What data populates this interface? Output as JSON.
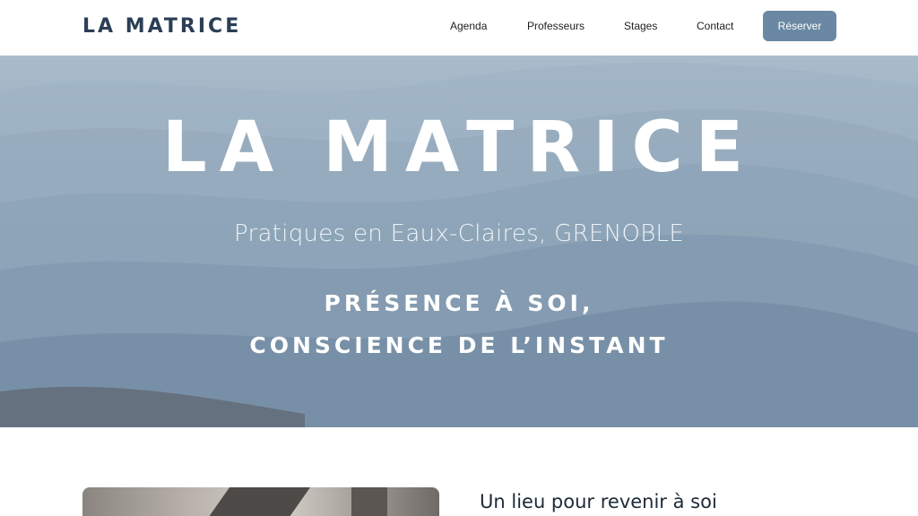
{
  "header": {
    "logo": "LA MATRICE",
    "nav": {
      "agenda": "Agenda",
      "professeurs": "Professeurs",
      "stages": "Stages",
      "contact": "Contact"
    },
    "reserve_label": "Réserver"
  },
  "hero": {
    "title": "LA MATRICE",
    "subtitle": "Pratiques en Eaux-Claires, GRENOBLE",
    "tagline_line1": "PRÉSENCE À SOI,",
    "tagline_line2": "CONSCIENCE DE L’INSTANT"
  },
  "section": {
    "heading": "Un lieu pour revenir à soi"
  },
  "colors": {
    "logo": "#2b3e56",
    "button": "#6a88a3",
    "hero_light": "#a9bccb",
    "hero_dark": "#6f889f"
  }
}
